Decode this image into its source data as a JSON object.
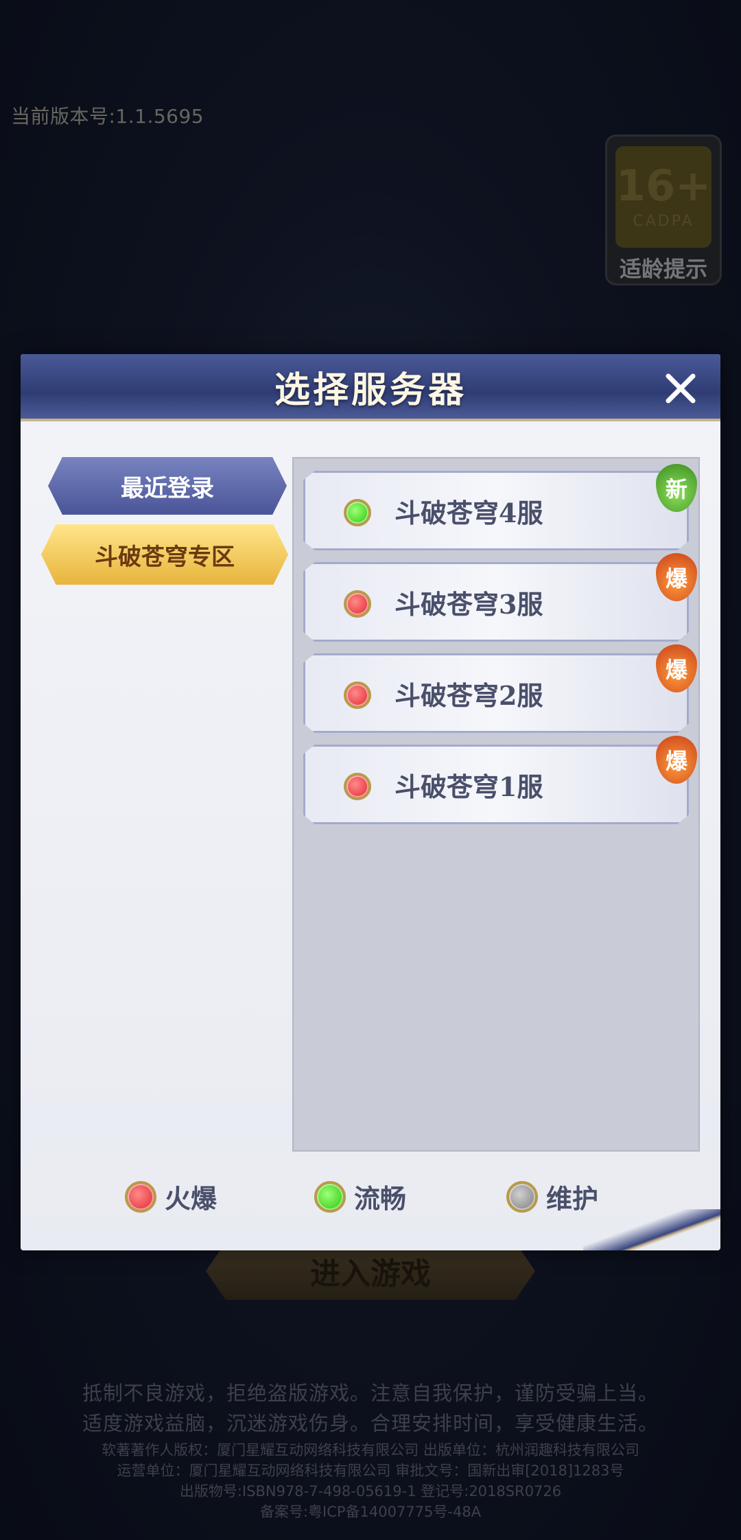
{
  "version_text": "当前版本号:1.1.5695",
  "age_rating": {
    "number": "16+",
    "org": "CADPA",
    "label": "适龄提示"
  },
  "dialog": {
    "title": "选择服务器",
    "tabs": [
      {
        "label": "最近登录",
        "active": false
      },
      {
        "label": "斗破苍穹专区",
        "active": true
      }
    ],
    "servers": [
      {
        "name": "斗破苍穹4服",
        "status": "green",
        "badge": "新"
      },
      {
        "name": "斗破苍穹3服",
        "status": "red",
        "badge": "爆"
      },
      {
        "name": "斗破苍穹2服",
        "status": "red",
        "badge": "爆"
      },
      {
        "name": "斗破苍穹1服",
        "status": "red",
        "badge": "爆"
      }
    ],
    "legend": [
      {
        "label": "火爆",
        "status": "red"
      },
      {
        "label": "流畅",
        "status": "green"
      },
      {
        "label": "维护",
        "status": "gray"
      }
    ]
  },
  "enter_button_label": "进入游戏",
  "footer": {
    "line1": "抵制不良游戏，拒绝盗版游戏。注意自我保护，谨防受骗上当。",
    "line2": "适度游戏益脑，沉迷游戏伤身。合理安排时间，享受健康生活。",
    "small1": "软著著作人版权：厦门星耀互动网络科技有限公司 出版单位：杭州润趣科技有限公司",
    "small2": "运营单位：厦门星耀互动网络科技有限公司 审批文号：国新出审[2018]1283号",
    "small3": "出版物号:ISBN978-7-498-05619-1 登记号:2018SR0726",
    "small4": "备案号:粤ICP备14007775号-48A"
  }
}
